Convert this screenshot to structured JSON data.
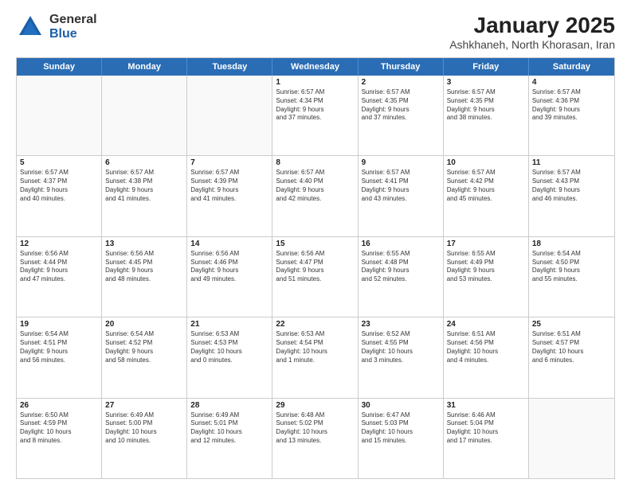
{
  "logo": {
    "general": "General",
    "blue": "Blue"
  },
  "title": "January 2025",
  "subtitle": "Ashkhaneh, North Khorasan, Iran",
  "header": {
    "days": [
      "Sunday",
      "Monday",
      "Tuesday",
      "Wednesday",
      "Thursday",
      "Friday",
      "Saturday"
    ]
  },
  "weeks": [
    [
      {
        "day": "",
        "info": "",
        "empty": true
      },
      {
        "day": "",
        "info": "",
        "empty": true
      },
      {
        "day": "",
        "info": "",
        "empty": true
      },
      {
        "day": "1",
        "info": "Sunrise: 6:57 AM\nSunset: 4:34 PM\nDaylight: 9 hours\nand 37 minutes."
      },
      {
        "day": "2",
        "info": "Sunrise: 6:57 AM\nSunset: 4:35 PM\nDaylight: 9 hours\nand 37 minutes."
      },
      {
        "day": "3",
        "info": "Sunrise: 6:57 AM\nSunset: 4:35 PM\nDaylight: 9 hours\nand 38 minutes."
      },
      {
        "day": "4",
        "info": "Sunrise: 6:57 AM\nSunset: 4:36 PM\nDaylight: 9 hours\nand 39 minutes."
      }
    ],
    [
      {
        "day": "5",
        "info": "Sunrise: 6:57 AM\nSunset: 4:37 PM\nDaylight: 9 hours\nand 40 minutes."
      },
      {
        "day": "6",
        "info": "Sunrise: 6:57 AM\nSunset: 4:38 PM\nDaylight: 9 hours\nand 41 minutes."
      },
      {
        "day": "7",
        "info": "Sunrise: 6:57 AM\nSunset: 4:39 PM\nDaylight: 9 hours\nand 41 minutes."
      },
      {
        "day": "8",
        "info": "Sunrise: 6:57 AM\nSunset: 4:40 PM\nDaylight: 9 hours\nand 42 minutes."
      },
      {
        "day": "9",
        "info": "Sunrise: 6:57 AM\nSunset: 4:41 PM\nDaylight: 9 hours\nand 43 minutes."
      },
      {
        "day": "10",
        "info": "Sunrise: 6:57 AM\nSunset: 4:42 PM\nDaylight: 9 hours\nand 45 minutes."
      },
      {
        "day": "11",
        "info": "Sunrise: 6:57 AM\nSunset: 4:43 PM\nDaylight: 9 hours\nand 46 minutes."
      }
    ],
    [
      {
        "day": "12",
        "info": "Sunrise: 6:56 AM\nSunset: 4:44 PM\nDaylight: 9 hours\nand 47 minutes."
      },
      {
        "day": "13",
        "info": "Sunrise: 6:56 AM\nSunset: 4:45 PM\nDaylight: 9 hours\nand 48 minutes."
      },
      {
        "day": "14",
        "info": "Sunrise: 6:56 AM\nSunset: 4:46 PM\nDaylight: 9 hours\nand 49 minutes."
      },
      {
        "day": "15",
        "info": "Sunrise: 6:56 AM\nSunset: 4:47 PM\nDaylight: 9 hours\nand 51 minutes."
      },
      {
        "day": "16",
        "info": "Sunrise: 6:55 AM\nSunset: 4:48 PM\nDaylight: 9 hours\nand 52 minutes."
      },
      {
        "day": "17",
        "info": "Sunrise: 6:55 AM\nSunset: 4:49 PM\nDaylight: 9 hours\nand 53 minutes."
      },
      {
        "day": "18",
        "info": "Sunrise: 6:54 AM\nSunset: 4:50 PM\nDaylight: 9 hours\nand 55 minutes."
      }
    ],
    [
      {
        "day": "19",
        "info": "Sunrise: 6:54 AM\nSunset: 4:51 PM\nDaylight: 9 hours\nand 56 minutes."
      },
      {
        "day": "20",
        "info": "Sunrise: 6:54 AM\nSunset: 4:52 PM\nDaylight: 9 hours\nand 58 minutes."
      },
      {
        "day": "21",
        "info": "Sunrise: 6:53 AM\nSunset: 4:53 PM\nDaylight: 10 hours\nand 0 minutes."
      },
      {
        "day": "22",
        "info": "Sunrise: 6:53 AM\nSunset: 4:54 PM\nDaylight: 10 hours\nand 1 minute."
      },
      {
        "day": "23",
        "info": "Sunrise: 6:52 AM\nSunset: 4:55 PM\nDaylight: 10 hours\nand 3 minutes."
      },
      {
        "day": "24",
        "info": "Sunrise: 6:51 AM\nSunset: 4:56 PM\nDaylight: 10 hours\nand 4 minutes."
      },
      {
        "day": "25",
        "info": "Sunrise: 6:51 AM\nSunset: 4:57 PM\nDaylight: 10 hours\nand 6 minutes."
      }
    ],
    [
      {
        "day": "26",
        "info": "Sunrise: 6:50 AM\nSunset: 4:59 PM\nDaylight: 10 hours\nand 8 minutes."
      },
      {
        "day": "27",
        "info": "Sunrise: 6:49 AM\nSunset: 5:00 PM\nDaylight: 10 hours\nand 10 minutes."
      },
      {
        "day": "28",
        "info": "Sunrise: 6:49 AM\nSunset: 5:01 PM\nDaylight: 10 hours\nand 12 minutes."
      },
      {
        "day": "29",
        "info": "Sunrise: 6:48 AM\nSunset: 5:02 PM\nDaylight: 10 hours\nand 13 minutes."
      },
      {
        "day": "30",
        "info": "Sunrise: 6:47 AM\nSunset: 5:03 PM\nDaylight: 10 hours\nand 15 minutes."
      },
      {
        "day": "31",
        "info": "Sunrise: 6:46 AM\nSunset: 5:04 PM\nDaylight: 10 hours\nand 17 minutes."
      },
      {
        "day": "",
        "info": "",
        "empty": true
      }
    ]
  ]
}
